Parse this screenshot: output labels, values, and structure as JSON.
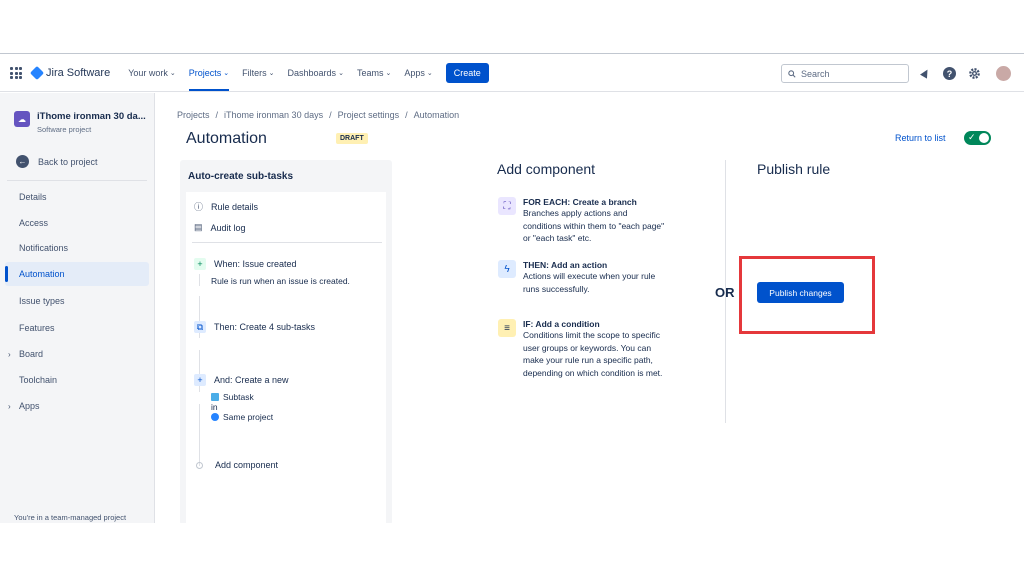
{
  "nav": {
    "logo": "Jira Software",
    "items": [
      "Your work",
      "Projects",
      "Filters",
      "Dashboards",
      "Teams",
      "Apps"
    ],
    "create": "Create",
    "search_placeholder": "Search"
  },
  "sidebar": {
    "project_name": "iThome ironman 30 da...",
    "project_type": "Software project",
    "back": "Back to project",
    "items": [
      "Details",
      "Access",
      "Notifications",
      "Automation",
      "Issue types",
      "Features",
      "Board",
      "Toolchain",
      "Apps"
    ],
    "footer": "You're in a team-managed project"
  },
  "breadcrumb": [
    "Projects",
    "iThome ironman 30 days",
    "Project settings",
    "Automation"
  ],
  "page": {
    "title": "Automation",
    "badge": "DRAFT",
    "return_link": "Return to list"
  },
  "rule": {
    "title": "Auto-create sub-tasks",
    "details": "Rule details",
    "audit": "Audit log",
    "trigger": "When: Issue created",
    "trigger_desc": "Rule is run when an issue is created.",
    "action1": "Then: Create 4 sub-tasks",
    "action2": "And: Create a new",
    "subtask": "Subtask",
    "in": "in",
    "same_project": "Same project",
    "add_component": "Add component"
  },
  "add_component": {
    "title": "Add component",
    "items": [
      {
        "head": "FOR EACH: Create a branch",
        "desc": "Branches apply actions and conditions within them to \"each page\" or \"each task\" etc."
      },
      {
        "head": "THEN: Add an action",
        "desc": "Actions will execute when your rule runs successfully."
      },
      {
        "head": "IF: Add a condition",
        "desc": "Conditions limit the scope to specific user groups or keywords. You can make your rule run a specific path, depending on which condition is met."
      }
    ]
  },
  "or": "OR",
  "publish": {
    "title": "Publish rule",
    "button": "Publish changes"
  }
}
